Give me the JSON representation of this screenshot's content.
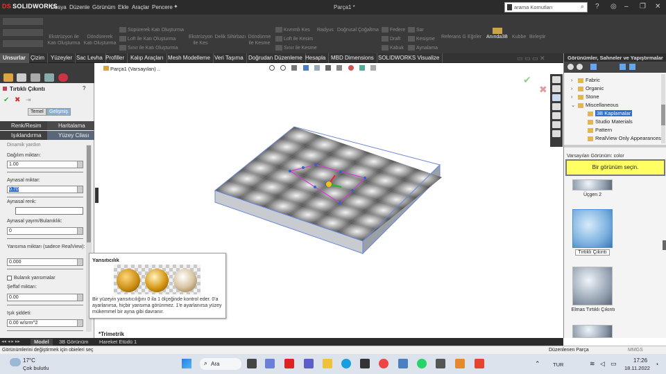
{
  "titlebar": {
    "app_name": "SOLIDWORKS",
    "menus": [
      "Dosya",
      "Düzenle",
      "Görünüm",
      "Ekle",
      "Araçlar",
      "Pencere"
    ],
    "doc_title": "Parça1 *",
    "search_placeholder": "arama Komutları"
  },
  "command_bar": {
    "items": [
      "Ekstrüzyon ile Katı Oluşturma",
      "Döndürerek Katı Oluşturma",
      "Süpürerek Katı Oluşturma",
      "Loft ile Katı Oluşturma",
      "Sınır ile Katı Oluşturma",
      "Ekstrüzyon ile Kes",
      "Delik Sihirbazı",
      "Döndürme ile Kesme",
      "Kıvrımlı Kes",
      "Loft ile Kesim",
      "Sınır ile Kesme",
      "Radyus",
      "Doğrusal Çoğaltma",
      "Federe",
      "Draft",
      "Kabuk",
      "Sar",
      "Kesişme",
      "Aynalama",
      "Referans Geometri",
      "Eğriler",
      "Anında3B",
      "Kubbe",
      "Birleştir"
    ]
  },
  "tabs": [
    "Unsurlar",
    "Çizim",
    "Yüzeyler",
    "Sac Levha",
    "Profiller",
    "Kalıp Araçları",
    "Mesh Modelleme",
    "Veri Taşıma",
    "Doğrudan Düzenleme",
    "Hesapla",
    "MBD Dimensions",
    "SOLIDWORKS Visualize"
  ],
  "property_manager": {
    "title": "Tırtıklı Çıkıntı",
    "mode_buttons": [
      "Temel",
      "Gelişmiş"
    ],
    "subtabs": [
      "Renk/Resim",
      "Haritalama",
      "Işıklandırma",
      "Yüzey Cilası"
    ],
    "dynamic_label": "Dinamik yardım",
    "fields": [
      {
        "label": "Dağılım miktarı:",
        "value": "1.00"
      },
      {
        "label": "Aynasal miktar:",
        "value": "0.70"
      },
      {
        "label": "Aynasal renk:",
        "value": ""
      },
      {
        "label": "Aynasal yayım/Bulanıklık:",
        "value": "0"
      },
      {
        "label": "Yansıma miktarı (sadece RealView):",
        "value": "0.000"
      },
      {
        "label": "Şeffaf miktarı:",
        "value": "0.00"
      },
      {
        "label": "Işık şiddeti:",
        "value": "0.00 w/srm^2"
      }
    ],
    "checkbox_label": "Bulanık yansımalar"
  },
  "tooltip": {
    "title": "Yansıtıcılık",
    "text": "Bir yüzeyin yansıtıcılığını 0 ila 1 ölçeğinde kontrol eder. 0'a ayarlanırsa, hiçbir yansıma görünmez. 1'e ayarlanırsa yüzey mükemmel bir ayna gibi davranır."
  },
  "viewport": {
    "tree_label": "Parça1 (Varsayılan) ..",
    "view_label": "*Trimetrik"
  },
  "right_panel": {
    "title": "Görünümler, Sahneler ve Yapıştırmalar",
    "tree": [
      {
        "label": "Fabric",
        "level": 1,
        "expanded": false
      },
      {
        "label": "Organic",
        "level": 1,
        "expanded": false
      },
      {
        "label": "Stone",
        "level": 1,
        "expanded": false
      },
      {
        "label": "Miscellaneous",
        "level": 1,
        "expanded": true
      },
      {
        "label": "3B Kaplamalar",
        "level": 2,
        "selected": true
      },
      {
        "label": "Studio Materials",
        "level": 2
      },
      {
        "label": "Pattern",
        "level": 2
      },
      {
        "label": "RealView Only Appearances",
        "level": 2
      }
    ],
    "default_label": "Varsayılan Görünüm: color",
    "prompt": "Bir görünüm seçin.",
    "tiles": [
      "Üçgen 2",
      "Tırtıklı Çıkıntı",
      "Elmas Tırtıklı Çıkıntı"
    ]
  },
  "bottom_tabs": [
    "Model",
    "3B Görünüm",
    "Hareket Etüdü 1"
  ],
  "status": {
    "left": "Görünümlerini değiştirmek için obieleri seç",
    "mode": "Düzenlenen Parça",
    "units": "MMGS"
  },
  "taskbar": {
    "temperature": "17°C",
    "weather": "Çok bulutlu",
    "search": "Ara",
    "language": "TUR",
    "time": "17:26",
    "date": "18.11.2022"
  },
  "colors": {
    "accent": "#2f6fcf",
    "prompt_bg": "#ffff64",
    "plate_light": "#dddddd",
    "plate_dark": "#2a2a2a"
  }
}
